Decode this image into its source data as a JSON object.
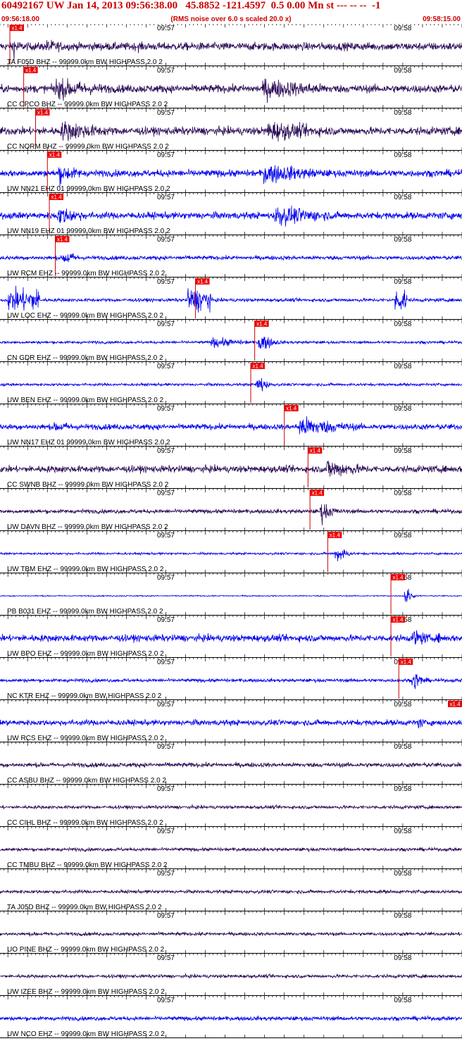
{
  "header": {
    "title": "60492167 UW Jan 14, 2013 09:56:38.00   45.8852 -121.4597  0.5 0.00 Mn st --- -- --  -1",
    "start_time": "09:56:18.00",
    "subtitle": "(RMS noise over 6.0 s scaled 20.0 x)",
    "end_time": "09:58:15.00"
  },
  "colors": {
    "header_red": "#cc0000",
    "dark_trace": "#2a0a55",
    "blue_trace": "#0000ee",
    "pick_box": "#ee0000"
  },
  "chart_data": {
    "type": "line",
    "time_range": [
      "09:56:18.00",
      "09:58:15.00"
    ],
    "minute_ticks": [
      {
        "label": "09:57",
        "time": "09:57:00"
      },
      {
        "label": "09:58",
        "time": "09:58:00"
      }
    ],
    "pick_label": "x1.4",
    "series": [
      {
        "name": "TA F05D BHZ -- 99999.0km BW  HIGHPASS  2.0  2",
        "color": "dark",
        "pick_s": 20.5,
        "amp": 0.35,
        "events": [
          [
            21.5,
            1.0,
            2
          ],
          [
            30,
            0.7,
            6
          ],
          [
            53,
            0.5,
            3
          ],
          [
            115,
            0.35,
            3
          ]
        ]
      },
      {
        "name": "CC CPCO BHZ -- 99999.0km BW  HIGHPASS  2.0  2",
        "color": "dark",
        "pick_s": 24,
        "amp": 0.35,
        "events": [
          [
            32,
            1.0,
            14
          ],
          [
            85,
            1.0,
            18
          ]
        ]
      },
      {
        "name": "CC NORM BHZ -- 99999.0km BW  HIGHPASS  2.0  2",
        "color": "dark",
        "pick_s": 27,
        "amp": 0.35,
        "events": [
          [
            34,
            1.0,
            12
          ],
          [
            86,
            1.0,
            16
          ]
        ]
      },
      {
        "name": "UW NN21 EHZ 01 99999.0km BW  HIGHPASS  2.0  2",
        "color": "blue",
        "pick_s": 30,
        "amp": 0.3,
        "events": [
          [
            33,
            0.9,
            6
          ],
          [
            85,
            1.0,
            14
          ]
        ]
      },
      {
        "name": "UW NN19 EHZ 01 99999.0km BW  HIGHPASS  2.0  2",
        "color": "blue",
        "pick_s": 30.5,
        "amp": 0.3,
        "events": [
          [
            33,
            0.9,
            7
          ],
          [
            88,
            1.0,
            14
          ]
        ]
      },
      {
        "name": "UW RCM EHZ -- 99999.0km BW  HIGHPASS  2.0  2",
        "color": "blue",
        "pick_s": 32,
        "amp": 0.18,
        "events": [
          [
            34.5,
            0.8,
            3
          ]
        ]
      },
      {
        "name": "UW LOC EHZ -- 99999.0km BW  HIGHPASS  2.0  2",
        "color": "blue",
        "pick_s": 67.5,
        "amp": 0.15,
        "glitches": [
          [
            20,
            8
          ],
          [
            65.5,
            6
          ],
          [
            118,
            3
          ],
          [
            155.5,
            3
          ]
        ]
      },
      {
        "name": "CN GDR EHZ -- 99999.0km BW  HIGHPASS  2.0  2",
        "color": "blue",
        "pick_s": 82.5,
        "amp": 0.12,
        "events": [
          [
            72,
            0.5,
            8
          ],
          [
            84,
            1.0,
            3
          ]
        ]
      },
      {
        "name": "UW BEN EHZ -- 99999.0km BW  HIGHPASS  2.0  2",
        "color": "blue",
        "pick_s": 81.5,
        "amp": 0.12,
        "events": [
          [
            83.5,
            1.0,
            2
          ]
        ]
      },
      {
        "name": "UW NN17 EHZ 01 99999.0km BW  HIGHPASS  2.0  2",
        "color": "blue",
        "pick_s": 90,
        "amp": 0.25,
        "events": [
          [
            32,
            0.5,
            10
          ],
          [
            94,
            1.0,
            12
          ]
        ]
      },
      {
        "name": "CC SWNB BHZ -- 99999.0km BW  HIGHPASS  2.0  2",
        "color": "dark",
        "pick_s": 96,
        "amp": 0.3,
        "events": [
          [
            101,
            1.0,
            9
          ]
        ]
      },
      {
        "name": "UW DAVN BHZ -- 99999.0km BW  HIGHPASS  2.0  2",
        "color": "dark",
        "pick_s": 96.5,
        "amp": 0.18,
        "events": [
          [
            99.5,
            1.0,
            3
          ],
          [
            156.5,
            0.6,
            2
          ]
        ]
      },
      {
        "name": "UW TBM EHZ -- 99999.0km BW  HIGHPASS  2.0  2",
        "color": "blue",
        "pick_s": 101,
        "amp": 0.1,
        "events": [
          [
            103.5,
            1.0,
            2
          ]
        ]
      },
      {
        "name": "PB B031 EHZ -- 99999.0km BW  HIGHPASS  2.0  2",
        "color": "blue",
        "pick_s": 117,
        "amp": 0.05,
        "events": [
          [
            8,
            0.4,
            0.5
          ],
          [
            121,
            1.0,
            1
          ]
        ]
      },
      {
        "name": "UW BPO EHZ -- 99999.0km BW  HIGHPASS  2.0  2",
        "color": "blue",
        "pick_s": 117,
        "amp": 0.3,
        "events": [
          [
            123,
            0.9,
            4
          ],
          [
            129,
            0.5,
            3
          ]
        ]
      },
      {
        "name": "NC KTR EHZ -- 99999.0km BW  HIGHPASS  2.0  2",
        "color": "blue",
        "pick_s": 119,
        "amp": 0.15,
        "events": [
          [
            123,
            1.0,
            2
          ]
        ]
      },
      {
        "name": "UW RCS EHZ -- 99999.0km BW  HIGHPASS  2.0  2",
        "color": "blue",
        "pick_s": 163,
        "amp": 0.25,
        "events": [
          [
            16,
            0.5,
            3
          ],
          [
            124,
            0.6,
            2
          ]
        ]
      },
      {
        "name": "CC ASBU BHZ -- 99999.0km BW  HIGHPASS  2.0  2",
        "color": "dark",
        "amp": 0.2
      },
      {
        "name": "CC CIHL BHZ -- 99999.0km BW  HIGHPASS  2.0  2",
        "color": "dark",
        "amp": 0.15
      },
      {
        "name": "CC TMBU BHZ -- 99999.0km BW  HIGHPASS  2.0  2",
        "color": "dark",
        "amp": 0.15
      },
      {
        "name": "TA J05D BHZ -- 99999.0km BW  HIGHPASS  2.0  2",
        "color": "dark",
        "amp": 0.15
      },
      {
        "name": "UO PINE BHZ -- 99999.0km BW  HIGHPASS  2.0  2",
        "color": "dark",
        "amp": 0.15
      },
      {
        "name": "UW IZEE BHZ -- 99999.0km BW  HIGHPASS  2.0  2",
        "color": "dark",
        "amp": 0.15
      },
      {
        "name": "UW NCO EHZ -- 99999.0km BW  HIGHPASS  2.0  2",
        "color": "blue",
        "amp": 0.18
      }
    ]
  }
}
